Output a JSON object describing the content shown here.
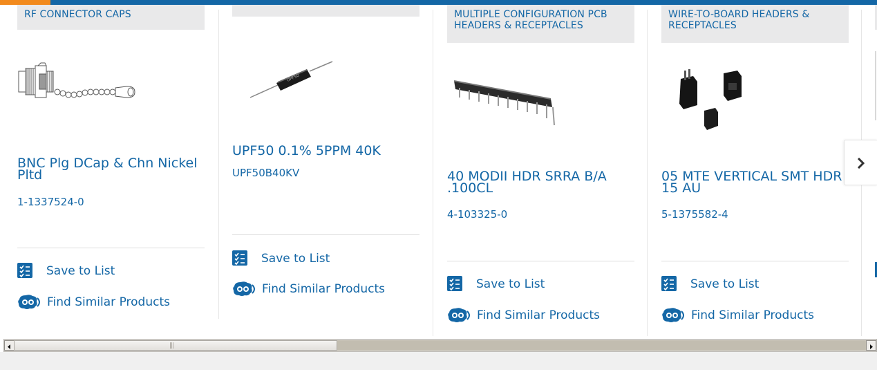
{
  "products": [
    {
      "category": "RF CONNECTOR CAPS",
      "name": "BNC Plg DCap & Chn Nickel Pltd",
      "part_number": "1-1337524-0",
      "save_label": "Save to List",
      "similar_label": "Find Similar Products",
      "image_icon": "bnc-cap-chain-drawing"
    },
    {
      "category": "",
      "name": "UPF50 0.1% 5PPM 40K",
      "part_number": "UPF50B40KV",
      "save_label": "Save to List",
      "similar_label": "Find Similar Products",
      "image_icon": "axial-resistor"
    },
    {
      "category": "MULTIPLE CONFIGURATION PCB HEADERS & RECEPTACLES",
      "name": "40 MODII HDR SRRA B/A .100CL",
      "part_number": "4-103325-0",
      "save_label": "Save to List",
      "similar_label": "Find Similar Products",
      "image_icon": "pin-header-strip"
    },
    {
      "category": "WIRE-TO-BOARD HEADERS & RECEPTACLES",
      "name": "05 MTE VERTICAL SMT HDR 15 AU",
      "part_number": "5-1375582-4",
      "save_label": "Save to List",
      "similar_label": "Find Similar Products",
      "image_icon": "black-headers"
    }
  ],
  "carousel": {
    "next_icon": "chevron-right-icon"
  },
  "colors": {
    "brand_blue": "#1467a6",
    "accent_orange": "#f28a1d",
    "tag_bg": "#e9e9ea"
  }
}
